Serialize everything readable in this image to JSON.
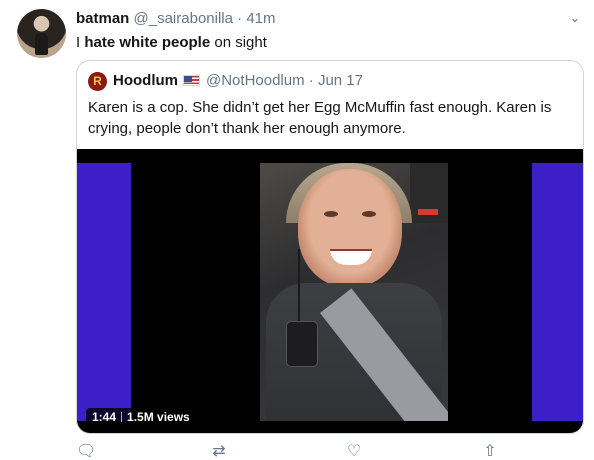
{
  "tweet": {
    "display_name": "batman",
    "handle": "@_sairabonilla",
    "separator": "·",
    "time": "41m",
    "text_pre": "I ",
    "text_bold": "hate white people",
    "text_post": " on sight",
    "menu_icon": "chevron-down-icon"
  },
  "quoted": {
    "avatar_letter": "R",
    "display_name": "Hoodlum",
    "flag": "us-flag-emoji",
    "handle": "@NotHoodlum",
    "separator": "·",
    "time": "Jun 17",
    "text": "Karen is a cop. She didn’t get her Egg McMuffin fast enough. Karen is crying, people don’t thank her enough anymore.",
    "video": {
      "duration": "1:44",
      "views": "1.5M views"
    }
  },
  "actions": [
    {
      "name": "reply",
      "icon": "reply-icon",
      "glyph": "🗨"
    },
    {
      "name": "retweet",
      "icon": "retweet-icon",
      "glyph": "⇄"
    },
    {
      "name": "like",
      "icon": "heart-icon",
      "glyph": "♡"
    },
    {
      "name": "share",
      "icon": "share-icon",
      "glyph": "⇧"
    }
  ],
  "colors": {
    "accent_bar": "#3d1fc7",
    "muted_text": "#657786",
    "border": "#ccd6dd"
  }
}
